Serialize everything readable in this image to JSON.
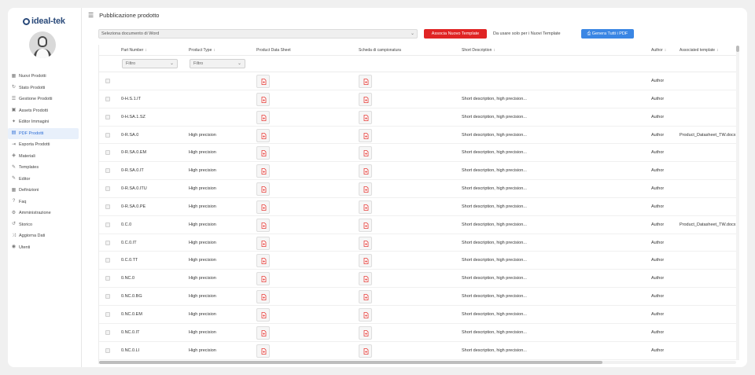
{
  "brand": {
    "name": "ideal-tek"
  },
  "sidebar": {
    "items": [
      {
        "label": "Nuovi Prodotti",
        "icon": "grid-icon"
      },
      {
        "label": "Stato Prodotti",
        "icon": "sync-icon"
      },
      {
        "label": "Gestione Prodotti",
        "icon": "list-icon"
      },
      {
        "label": "Assets Prodotti",
        "icon": "image-icon"
      },
      {
        "label": "Editor Immagini",
        "icon": "wand-icon"
      },
      {
        "label": "PDF Prodotti",
        "icon": "file-icon",
        "active": true
      },
      {
        "label": "Esporta Prodotti",
        "icon": "export-icon"
      },
      {
        "label": "Materiali",
        "icon": "layers-icon"
      },
      {
        "label": "Templates",
        "icon": "edit-icon"
      },
      {
        "label": "Editor",
        "icon": "edit-icon"
      },
      {
        "label": "Definizioni",
        "icon": "calendar-icon"
      },
      {
        "label": "Faq",
        "icon": "help-icon"
      },
      {
        "label": "Amministrazione",
        "icon": "gear-icon"
      },
      {
        "label": "Storico",
        "icon": "history-icon"
      },
      {
        "label": "Aggiorna Dati",
        "icon": "shuffle-icon"
      },
      {
        "label": "Utenti",
        "icon": "eye-icon"
      }
    ]
  },
  "header": {
    "title": "Pubblicazione prodotto"
  },
  "controls": {
    "word_select": "Seleziona documento di Word",
    "associate_button": "Associa Nuovo Template",
    "note": "Da usare solo per i Nuovi Template",
    "generate_button": "Genera Tutti i PDF"
  },
  "table": {
    "columns": {
      "part_number": "Part Number",
      "product_type": "Product Type",
      "datasheet": "Product Data Sheet",
      "sampling": "Scheda di campionatura",
      "short_desc": "Short Description",
      "author": "Author",
      "template": "Associated template"
    },
    "filter_placeholder": "Filtro",
    "rows": [
      {
        "part": "",
        "type": "",
        "desc": "",
        "author": "Author",
        "template": ""
      },
      {
        "part": "0-H.S.1.IT",
        "type": "",
        "desc": "Short description, high precision...",
        "author": "Author",
        "template": ""
      },
      {
        "part": "0-H.SA.1.SZ",
        "type": "",
        "desc": "Short description, high precision...",
        "author": "Author",
        "template": ""
      },
      {
        "part": "0-R.SA.0",
        "type": "High precision",
        "desc": "Short description, high precision...",
        "author": "Author",
        "template": "Product_Datasheet_TW.docx"
      },
      {
        "part": "0-R.SA.0.EM",
        "type": "High precision",
        "desc": "Short description, high precision...",
        "author": "Author",
        "template": ""
      },
      {
        "part": "0-R.SA.0.IT",
        "type": "High precision",
        "desc": "Short description, high precision...",
        "author": "Author",
        "template": ""
      },
      {
        "part": "0-R.SA.0.ITU",
        "type": "High precision",
        "desc": "Short description, high precision...",
        "author": "Author",
        "template": ""
      },
      {
        "part": "0-R.SA.0.PE",
        "type": "High precision",
        "desc": "Short description, high precision...",
        "author": "Author",
        "template": ""
      },
      {
        "part": "0.C.0",
        "type": "High precision",
        "desc": "Short description, high precision...",
        "author": "Author",
        "template": "Product_Datasheet_TW.docx"
      },
      {
        "part": "0.C.0.IT",
        "type": "High precision",
        "desc": "Short description, high precision...",
        "author": "Author",
        "template": ""
      },
      {
        "part": "0.C.0.TT",
        "type": "High precision",
        "desc": "Short description, high precision...",
        "author": "Author",
        "template": ""
      },
      {
        "part": "0.NC.0",
        "type": "High precision",
        "desc": "Short description, high precision...",
        "author": "Author",
        "template": ""
      },
      {
        "part": "0.NC.0.BG",
        "type": "High precision",
        "desc": "Short description, high precision...",
        "author": "Author",
        "template": ""
      },
      {
        "part": "0.NC.0.EM",
        "type": "High precision",
        "desc": "Short description, high precision...",
        "author": "Author",
        "template": ""
      },
      {
        "part": "0.NC.0.IT",
        "type": "High precision",
        "desc": "Short description, high precision...",
        "author": "Author",
        "template": ""
      },
      {
        "part": "0.NC.0.LI",
        "type": "High precision",
        "desc": "Short description, high precision...",
        "author": "Author",
        "template": ""
      }
    ]
  }
}
